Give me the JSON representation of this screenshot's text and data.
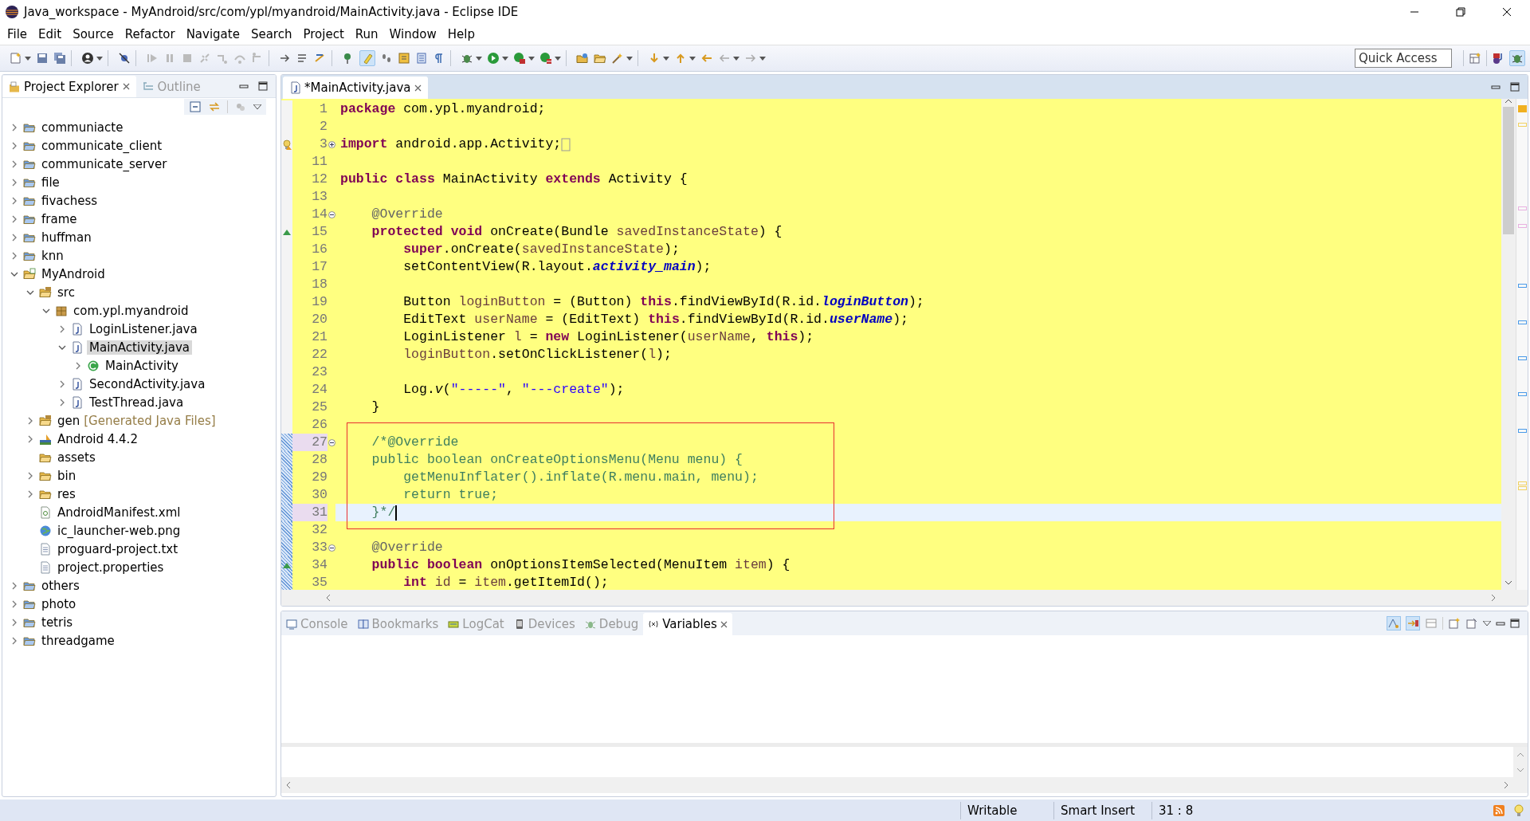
{
  "window": {
    "title": "Java_workspace - MyAndroid/src/com/ypl/myandroid/MainActivity.java - Eclipse IDE"
  },
  "menu": [
    "File",
    "Edit",
    "Source",
    "Refactor",
    "Navigate",
    "Search",
    "Project",
    "Run",
    "Window",
    "Help"
  ],
  "quick_access": {
    "placeholder": "Quick Access"
  },
  "left_tabs": [
    {
      "label": "Project Explorer",
      "selected": true
    },
    {
      "label": "Outline",
      "selected": false
    }
  ],
  "tree": [
    {
      "label": "communiacte",
      "kind": "project",
      "expanded": false,
      "selected": false
    },
    {
      "label": "communicate_client",
      "kind": "project",
      "expanded": false,
      "selected": false
    },
    {
      "label": "communicate_server",
      "kind": "project",
      "expanded": false,
      "selected": false
    },
    {
      "label": "file",
      "kind": "project",
      "expanded": false,
      "selected": false
    },
    {
      "label": "fivachess",
      "kind": "project",
      "expanded": false,
      "selected": false
    },
    {
      "label": "frame",
      "kind": "project",
      "expanded": false,
      "selected": false
    },
    {
      "label": "huffman",
      "kind": "project",
      "expanded": false,
      "selected": false
    },
    {
      "label": "knn",
      "kind": "project",
      "expanded": false,
      "selected": false
    },
    {
      "label": "MyAndroid",
      "kind": "android",
      "expanded": true,
      "selected": false,
      "children": [
        {
          "label": "src",
          "kind": "source",
          "expanded": true,
          "selected": false,
          "children": [
            {
              "label": "com.ypl.myandroid",
              "kind": "package",
              "expanded": true,
              "selected": false,
              "children": [
                {
                  "label": "LoginListener.java",
                  "kind": "java",
                  "expanded": false,
                  "selected": false
                },
                {
                  "label": "MainActivity.java",
                  "kind": "java",
                  "expanded": true,
                  "selected": true,
                  "children": [
                    {
                      "label": "MainActivity",
                      "kind": "class",
                      "expanded": false,
                      "selected": false
                    }
                  ]
                },
                {
                  "label": "SecondActivity.java",
                  "kind": "java",
                  "expanded": false,
                  "selected": false
                },
                {
                  "label": "TestThread.java",
                  "kind": "java",
                  "expanded": false,
                  "selected": false
                }
              ]
            }
          ]
        },
        {
          "label": "gen",
          "note": "[Generated Java Files]",
          "kind": "source",
          "expanded": false,
          "selected": false
        },
        {
          "label": "Android 4.4.2",
          "kind": "library",
          "expanded": false,
          "selected": false
        },
        {
          "label": "assets",
          "kind": "folder",
          "selected": false
        },
        {
          "label": "bin",
          "kind": "folder",
          "expanded": false,
          "selected": false
        },
        {
          "label": "res",
          "kind": "folder",
          "expanded": false,
          "selected": false
        },
        {
          "label": "AndroidManifest.xml",
          "kind": "xml",
          "selected": false
        },
        {
          "label": "ic_launcher-web.png",
          "kind": "image",
          "selected": false
        },
        {
          "label": "proguard-project.txt",
          "kind": "text",
          "selected": false
        },
        {
          "label": "project.properties",
          "kind": "text",
          "selected": false
        }
      ]
    },
    {
      "label": "others",
      "kind": "project",
      "expanded": false,
      "selected": false
    },
    {
      "label": "photo",
      "kind": "project",
      "expanded": false,
      "selected": false
    },
    {
      "label": "tetris",
      "kind": "project",
      "expanded": false,
      "selected": false
    },
    {
      "label": "threadgame",
      "kind": "project",
      "expanded": false,
      "selected": false
    }
  ],
  "editor_tabs": [
    {
      "label": "*MainActivity.java",
      "selected": true
    }
  ],
  "code": [
    {
      "number": "1",
      "current": false,
      "changed": false,
      "shaded": false,
      "boxed": false,
      "tokens": [
        {
          "kind": "kw",
          "text": "package"
        },
        {
          "kind": "t",
          "text": " com.ypl.myandroid;"
        }
      ]
    },
    {
      "number": "2",
      "current": false,
      "changed": false,
      "shaded": false,
      "boxed": false
    },
    {
      "number": "3",
      "current": false,
      "changed": false,
      "shaded": false,
      "boxed": false,
      "collapsed": true,
      "warning": true,
      "tokens": [
        {
          "kind": "kw",
          "text": "import"
        },
        {
          "kind": "t",
          "text": " android.app.Activity;"
        }
      ]
    },
    {
      "number": "11",
      "current": false,
      "changed": false,
      "shaded": false,
      "boxed": false
    },
    {
      "number": "12",
      "current": false,
      "changed": false,
      "shaded": false,
      "boxed": false,
      "tokens": [
        {
          "kind": "kw",
          "text": "public "
        },
        {
          "kind": "kw",
          "text": "class"
        },
        {
          "kind": "t",
          "text": " MainActivity "
        },
        {
          "kind": "kw",
          "text": "extends"
        },
        {
          "kind": "t",
          "text": " Activity {"
        }
      ]
    },
    {
      "number": "13",
      "current": false,
      "changed": false,
      "shaded": false,
      "boxed": false
    },
    {
      "number": "14",
      "current": false,
      "changed": false,
      "shaded": false,
      "boxed": false,
      "collapsed": false,
      "tokens": [
        {
          "kind": "ann",
          "text": "    @Override"
        }
      ]
    },
    {
      "number": "15",
      "current": false,
      "changed": false,
      "shaded": false,
      "boxed": false,
      "override": true,
      "tokens": [
        {
          "kind": "kw",
          "text": "    protected "
        },
        {
          "kind": "kw",
          "text": "void"
        },
        {
          "kind": "t",
          "text": " onCreate(Bundle "
        },
        {
          "kind": "var",
          "text": "savedInstanceState"
        },
        {
          "kind": "t",
          "text": ") {"
        }
      ]
    },
    {
      "number": "16",
      "current": false,
      "changed": false,
      "shaded": false,
      "boxed": false,
      "tokens": [
        {
          "kind": "kw",
          "text": "        super"
        },
        {
          "kind": "t",
          "text": ".onCreate("
        },
        {
          "kind": "var",
          "text": "savedInstanceState"
        },
        {
          "kind": "t",
          "text": ");"
        }
      ]
    },
    {
      "number": "17",
      "current": false,
      "changed": false,
      "shaded": false,
      "boxed": false,
      "tokens": [
        {
          "kind": "t",
          "text": "        setContentView(R.layout."
        },
        {
          "kind": "fld",
          "text": "activity_main"
        },
        {
          "kind": "t",
          "text": ");"
        }
      ]
    },
    {
      "number": "18",
      "current": false,
      "changed": false,
      "shaded": false,
      "boxed": false
    },
    {
      "number": "19",
      "current": false,
      "changed": false,
      "shaded": false,
      "boxed": false,
      "tokens": [
        {
          "kind": "t",
          "text": "        Button "
        },
        {
          "kind": "var",
          "text": "loginButton"
        },
        {
          "kind": "t",
          "text": " = (Button) "
        },
        {
          "kind": "kw",
          "text": "this"
        },
        {
          "kind": "t",
          "text": ".findViewById(R.id."
        },
        {
          "kind": "fld",
          "text": "loginButton"
        },
        {
          "kind": "t",
          "text": ");"
        }
      ]
    },
    {
      "number": "20",
      "current": false,
      "changed": false,
      "shaded": false,
      "boxed": false,
      "tokens": [
        {
          "kind": "t",
          "text": "        EditText "
        },
        {
          "kind": "var",
          "text": "userName"
        },
        {
          "kind": "t",
          "text": " = (EditText) "
        },
        {
          "kind": "kw",
          "text": "this"
        },
        {
          "kind": "t",
          "text": ".findViewById(R.id."
        },
        {
          "kind": "fld",
          "text": "userName"
        },
        {
          "kind": "t",
          "text": ");"
        }
      ]
    },
    {
      "number": "21",
      "current": false,
      "changed": false,
      "shaded": false,
      "boxed": false,
      "tokens": [
        {
          "kind": "t",
          "text": "        LoginListener "
        },
        {
          "kind": "var",
          "text": "l"
        },
        {
          "kind": "t",
          "text": " = "
        },
        {
          "kind": "kw",
          "text": "new"
        },
        {
          "kind": "t",
          "text": " LoginListener("
        },
        {
          "kind": "var",
          "text": "userName"
        },
        {
          "kind": "t",
          "text": ", "
        },
        {
          "kind": "kw",
          "text": "this"
        },
        {
          "kind": "t",
          "text": ");"
        }
      ]
    },
    {
      "number": "22",
      "current": false,
      "changed": false,
      "shaded": false,
      "boxed": false,
      "tokens": [
        {
          "kind": "var",
          "text": "        loginButton"
        },
        {
          "kind": "t",
          "text": ".setOnClickListener("
        },
        {
          "kind": "var",
          "text": "l"
        },
        {
          "kind": "t",
          "text": ");"
        }
      ]
    },
    {
      "number": "23",
      "current": false,
      "changed": false,
      "shaded": false,
      "boxed": false
    },
    {
      "number": "24",
      "current": false,
      "changed": false,
      "shaded": false,
      "boxed": false,
      "tokens": [
        {
          "kind": "t",
          "text": "        Log."
        },
        {
          "kind": "it",
          "text": "v"
        },
        {
          "kind": "t",
          "text": "("
        },
        {
          "kind": "str",
          "text": "\"-----\""
        },
        {
          "kind": "t",
          "text": ", "
        },
        {
          "kind": "str",
          "text": "\"---create\""
        },
        {
          "kind": "t",
          "text": ");"
        }
      ]
    },
    {
      "number": "25",
      "current": false,
      "changed": false,
      "shaded": false,
      "boxed": false,
      "tokens": [
        {
          "kind": "t",
          "text": "    }"
        }
      ]
    },
    {
      "number": "26",
      "current": false,
      "changed": false,
      "shaded": false,
      "boxed": false
    },
    {
      "number": "27",
      "current": false,
      "changed": true,
      "shaded": true,
      "boxed": true,
      "collapsed": false,
      "tokens": [
        {
          "kind": "cm",
          "text": "    /*@Override"
        }
      ]
    },
    {
      "number": "28",
      "current": false,
      "changed": true,
      "shaded": false,
      "boxed": true,
      "tokens": [
        {
          "kind": "cm",
          "text": "    public boolean onCreateOptionsMenu(Menu menu) {"
        }
      ]
    },
    {
      "number": "29",
      "current": false,
      "changed": true,
      "shaded": false,
      "boxed": true,
      "tokens": [
        {
          "kind": "cm",
          "text": "        getMenuInflater().inflate(R.menu.main, menu);"
        }
      ]
    },
    {
      "number": "30",
      "current": false,
      "changed": true,
      "shaded": false,
      "boxed": true,
      "tokens": [
        {
          "kind": "cm",
          "text": "        return true;"
        }
      ]
    },
    {
      "number": "31",
      "current": true,
      "changed": true,
      "shaded": true,
      "boxed": true,
      "tokens": [
        {
          "kind": "cm",
          "text": "    }*/"
        }
      ]
    },
    {
      "number": "32",
      "current": false,
      "changed": true,
      "shaded": false,
      "boxed": false
    },
    {
      "number": "33",
      "current": false,
      "changed": true,
      "shaded": false,
      "boxed": false,
      "collapsed": false,
      "tokens": [
        {
          "kind": "ann",
          "text": "    @Override"
        }
      ]
    },
    {
      "number": "34",
      "current": false,
      "changed": true,
      "shaded": false,
      "boxed": false,
      "override": true,
      "tokens": [
        {
          "kind": "kw",
          "text": "    public "
        },
        {
          "kind": "kw",
          "text": "boolean"
        },
        {
          "kind": "t",
          "text": " onOptionsItemSelected(MenuItem "
        },
        {
          "kind": "var",
          "text": "item"
        },
        {
          "kind": "t",
          "text": ") {"
        }
      ]
    },
    {
      "number": "35",
      "current": false,
      "changed": true,
      "shaded": false,
      "boxed": false,
      "tokens": [
        {
          "kind": "kw",
          "text": "        int "
        },
        {
          "kind": "var",
          "text": "id"
        },
        {
          "kind": "t",
          "text": " = "
        },
        {
          "kind": "var",
          "text": "item"
        },
        {
          "kind": "t",
          "text": ".getItemId();"
        }
      ]
    }
  ],
  "bottom_tabs": [
    {
      "label": "Console",
      "kind": "console",
      "selected": false
    },
    {
      "label": "Bookmarks",
      "kind": "bookmarks",
      "selected": false
    },
    {
      "label": "LogCat",
      "kind": "logcat",
      "selected": false
    },
    {
      "label": "Devices",
      "kind": "devices",
      "selected": false
    },
    {
      "label": "Debug",
      "kind": "debug",
      "selected": false
    },
    {
      "label": "Variables",
      "kind": "variables",
      "selected": true
    }
  ],
  "status_bar": [
    "Writable",
    "Smart Insert",
    "31 : 8"
  ]
}
